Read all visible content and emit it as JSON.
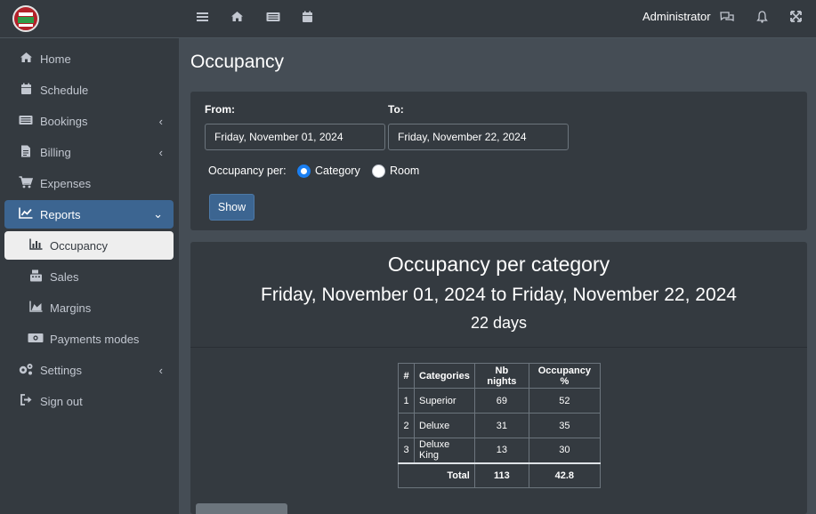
{
  "sidebar": {
    "items": [
      {
        "label": "Home",
        "icon": "home-icon"
      },
      {
        "label": "Schedule",
        "icon": "calendar-icon"
      },
      {
        "label": "Bookings",
        "icon": "bookings-icon"
      },
      {
        "label": "Billing",
        "icon": "invoice-icon"
      },
      {
        "label": "Expenses",
        "icon": "cart-icon"
      },
      {
        "label": "Reports",
        "icon": "chart-icon"
      },
      {
        "label": "Occupancy",
        "icon": "bar-chart-icon"
      },
      {
        "label": "Sales",
        "icon": "cash-register-icon"
      },
      {
        "label": "Margins",
        "icon": "area-chart-icon"
      },
      {
        "label": "Payments modes",
        "icon": "money-icon"
      },
      {
        "label": "Settings",
        "icon": "cogs-icon"
      },
      {
        "label": "Sign out",
        "icon": "sign-out-icon"
      }
    ]
  },
  "topbar": {
    "user": "Administrator"
  },
  "page": {
    "title": "Occupancy"
  },
  "form": {
    "from_label": "From:",
    "from_value": "Friday, November 01, 2024",
    "to_label": "To:",
    "to_value": "Friday, November 22, 2024",
    "occupancy_per_label": "Occupancy per:",
    "option_category": "Category",
    "option_room": "Room",
    "selected": "Category",
    "show_button": "Show"
  },
  "report": {
    "title": "Occupancy per category",
    "range": "Friday, November 01, 2024 to Friday, November 22, 2024",
    "days": "22 days",
    "table": {
      "headers": [
        "#",
        "Categories",
        "Nb nights",
        "Occupancy %"
      ],
      "rows": [
        {
          "num": "1",
          "category": "Superior",
          "nights": "69",
          "pct": "52"
        },
        {
          "num": "2",
          "category": "Deluxe",
          "nights": "31",
          "pct": "35"
        },
        {
          "num": "3",
          "category": "Deluxe King",
          "nights": "13",
          "pct": "30"
        }
      ],
      "total_label": "Total",
      "total_nights": "113",
      "total_pct": "42.8"
    }
  },
  "colors": {
    "sidebar_bg": "#343a40",
    "content_bg": "#454d55",
    "accent": "#3c6591",
    "radio_checked": "#1a7ff2"
  }
}
